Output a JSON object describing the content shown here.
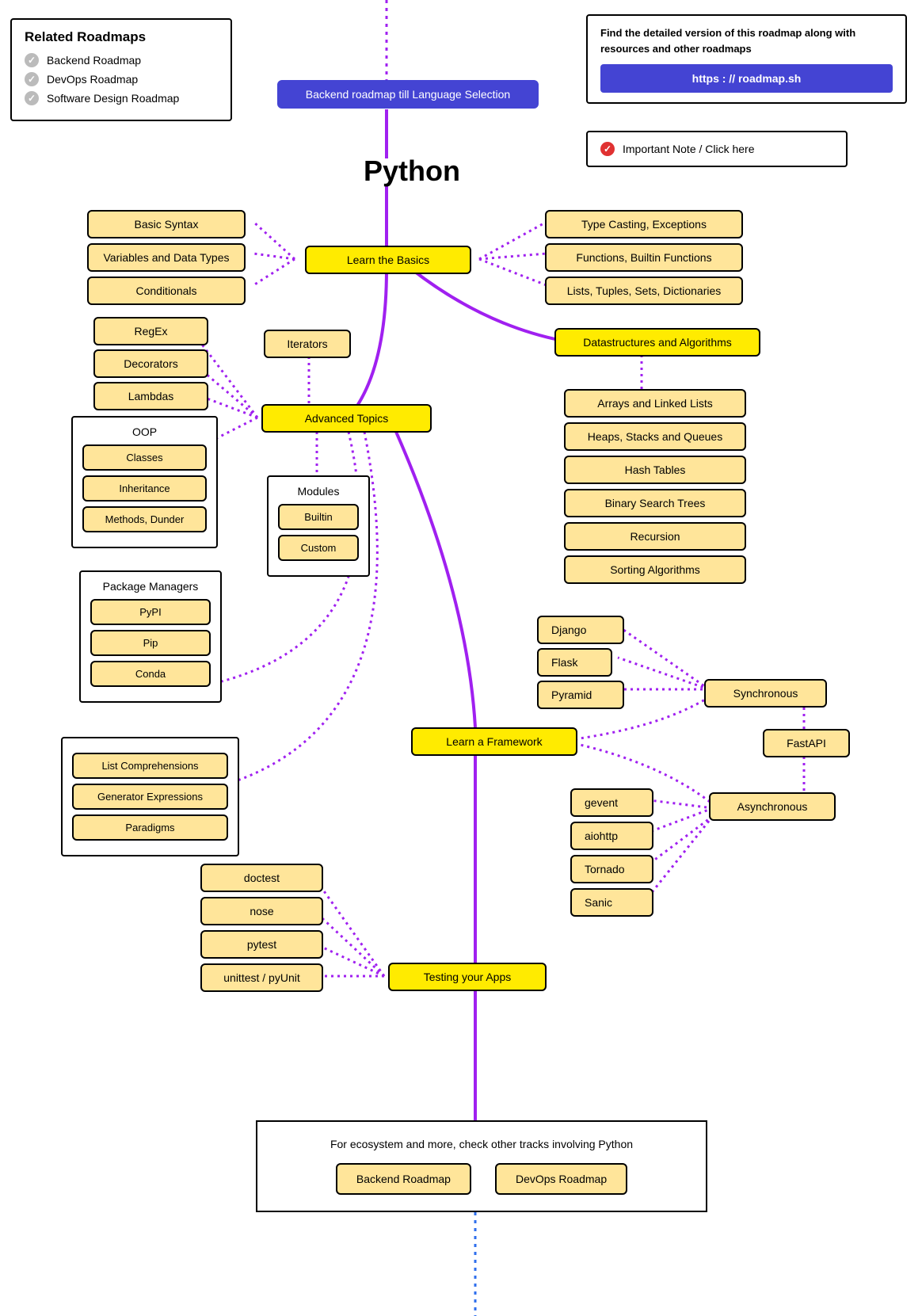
{
  "related_roadmaps": {
    "title": "Related Roadmaps",
    "items": [
      "Backend Roadmap",
      "DevOps Roadmap",
      "Software Design Roadmap"
    ]
  },
  "info_box": {
    "desc": "Find the detailed version of this roadmap along with resources and other roadmaps",
    "link": "https : // roadmap.sh"
  },
  "note": "Important Note / Click here",
  "backend_link": "Backend roadmap till Language Selection",
  "page_title": "Python",
  "basics": {
    "main": "Learn the Basics",
    "left": [
      "Basic Syntax",
      "Variables and Data Types",
      "Conditionals"
    ],
    "right": [
      "Type Casting, Exceptions",
      "Functions, Builtin Functions",
      "Lists, Tuples, Sets, Dictionaries"
    ]
  },
  "dsa": {
    "main": "Datastructures and Algorithms",
    "items": [
      "Arrays and Linked Lists",
      "Heaps, Stacks and Queues",
      "Hash Tables",
      "Binary Search Trees",
      "Recursion",
      "Sorting Algorithms"
    ]
  },
  "advanced": {
    "main": "Advanced Topics",
    "iterators": "Iterators",
    "left": [
      "RegEx",
      "Decorators",
      "Lambdas"
    ],
    "oop": {
      "title": "OOP",
      "items": [
        "Classes",
        "Inheritance",
        "Methods, Dunder"
      ]
    },
    "modules": {
      "title": "Modules",
      "items": [
        "Builtin",
        "Custom"
      ]
    },
    "pkg": {
      "title": "Package Managers",
      "items": [
        "PyPI",
        "Pip",
        "Conda"
      ]
    },
    "extras": [
      "List Comprehensions",
      "Generator Expressions",
      "Paradigms"
    ]
  },
  "frameworks": {
    "main": "Learn a Framework",
    "sync": "Synchronous",
    "sync_items": [
      "Django",
      "Flask",
      "Pyramid"
    ],
    "fastapi": "FastAPI",
    "async": "Asynchronous",
    "async_items": [
      "gevent",
      "aiohttp",
      "Tornado",
      "Sanic"
    ]
  },
  "testing": {
    "main": "Testing your Apps",
    "items": [
      "doctest",
      "nose",
      "pytest",
      "unittest / pyUnit"
    ]
  },
  "footer": {
    "text": "For ecosystem and more, check other tracks involving Python",
    "buttons": [
      "Backend Roadmap",
      "DevOps Roadmap"
    ]
  }
}
